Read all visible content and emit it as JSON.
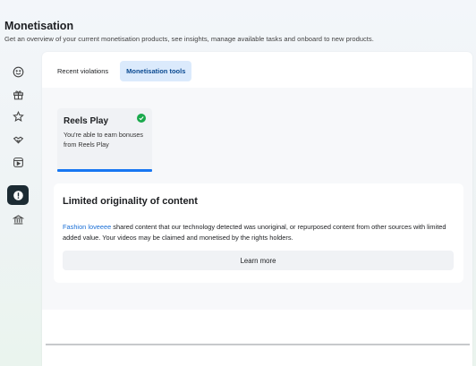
{
  "header": {
    "title": "Monetisation",
    "subtitle": "Get an overview of your current monetisation products, see insights, manage available tasks and onboard to new products."
  },
  "sidebar": {
    "icons": [
      "smiley-face-icon",
      "gift-icon",
      "star-badge-icon",
      "handshake-icon",
      "reels-icon",
      "alert-icon",
      "bank-icon"
    ],
    "active": "alert-icon"
  },
  "tabs": [
    {
      "label": "Recent violations",
      "active": false
    },
    {
      "label": "Monetisation tools",
      "active": true
    }
  ],
  "product_card": {
    "title": "Reels Play",
    "description": "You're able to earn bonuses from Reels Play",
    "status_icon": "check-circle-icon",
    "status_color": "#1aa94c"
  },
  "info_card": {
    "title": "Limited originality of content",
    "link_text": "Fashion loveeee",
    "body": " shared content that our technology detected was unoriginal, or repurposed content from other sources with limited added value. Your videos may be claimed and monetised by the rights holders.",
    "button_label": "Learn more"
  },
  "colors": {
    "accent": "#1877f2",
    "tab_active_bg": "#dbeafc",
    "link": "#1a6fd6"
  }
}
